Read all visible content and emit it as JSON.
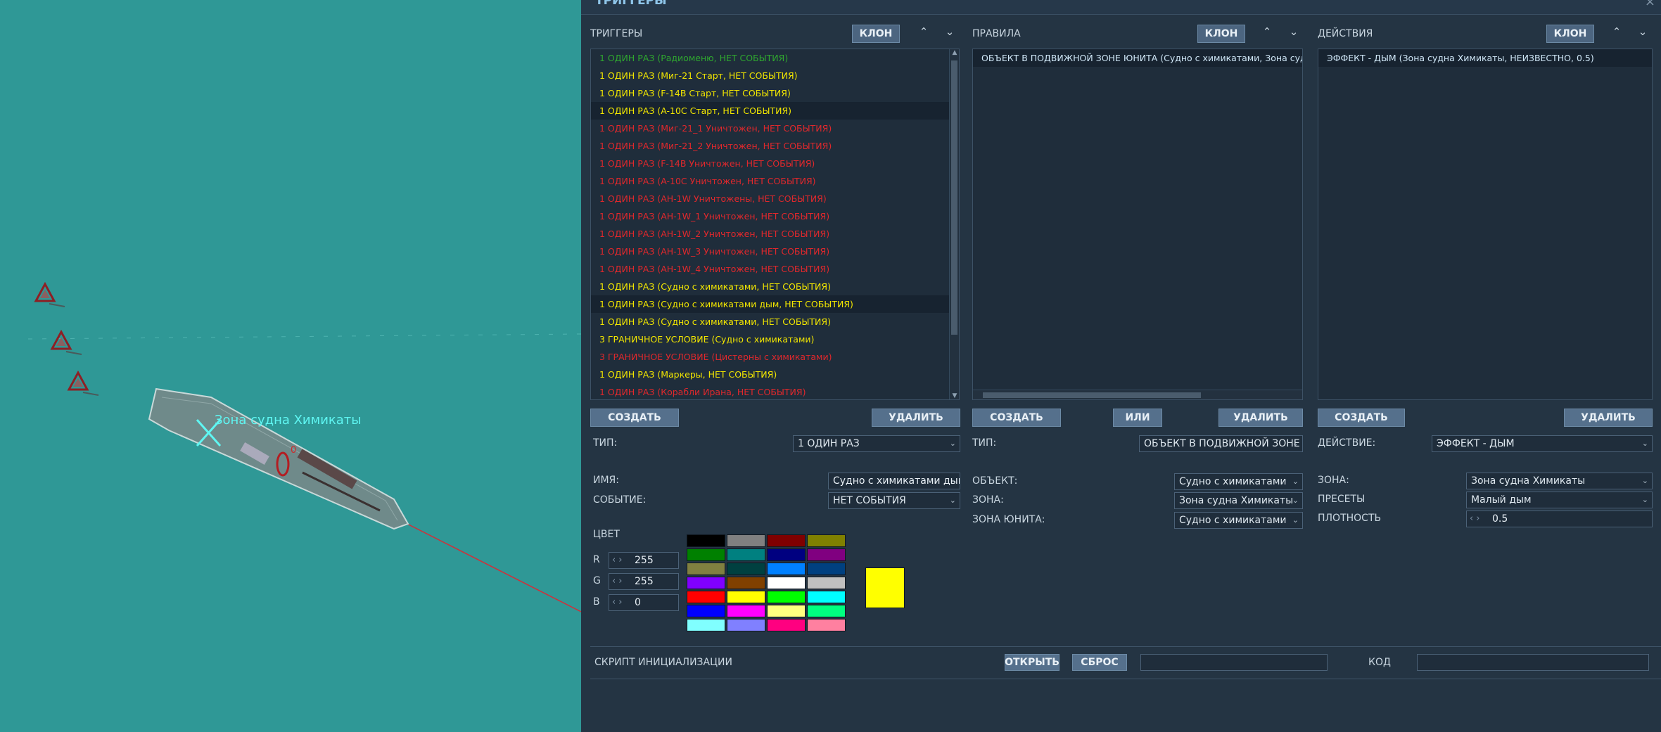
{
  "map": {
    "zone_label": "Зона судна Химикаты",
    "ship_marker": "0",
    "colors": {
      "water": "#2f9896",
      "zone": "#5ff6f2",
      "route": "#d0303a"
    }
  },
  "window": {
    "title": "ТРИГГЕРЫ",
    "close": "×"
  },
  "triggers": {
    "header": "ТРИГГЕРЫ",
    "clone": "КЛОН",
    "up_icon": "⌃",
    "down_icon": "⌄",
    "items": [
      {
        "text": "1 ОДИН РАЗ (Радиоменю, НЕТ СОБЫТИЯ)",
        "color": "#2fa82f"
      },
      {
        "text": "1 ОДИН РАЗ (Миг-21 Старт, НЕТ СОБЫТИЯ)",
        "color": "#f2e600"
      },
      {
        "text": "1 ОДИН РАЗ (F-14B Старт, НЕТ СОБЫТИЯ)",
        "color": "#f2e600"
      },
      {
        "text": "1 ОДИН РАЗ (A-10C Старт, НЕТ СОБЫТИЯ)",
        "color": "#f2e600"
      },
      {
        "text": "1 ОДИН РАЗ (Миг-21_1 Уничтожен, НЕТ СОБЫТИЯ)",
        "color": "#e0282c"
      },
      {
        "text": "1 ОДИН РАЗ (Миг-21_2 Уничтожен, НЕТ СОБЫТИЯ)",
        "color": "#e0282c"
      },
      {
        "text": "1 ОДИН РАЗ (F-14B Уничтожен, НЕТ СОБЫТИЯ)",
        "color": "#e0282c"
      },
      {
        "text": "1 ОДИН РАЗ (A-10C Уничтожен, НЕТ СОБЫТИЯ)",
        "color": "#e0282c"
      },
      {
        "text": "1 ОДИН РАЗ (AH-1W Уничтожены, НЕТ СОБЫТИЯ)",
        "color": "#e0282c"
      },
      {
        "text": "1 ОДИН РАЗ (AH-1W_1 Уничтожен, НЕТ СОБЫТИЯ)",
        "color": "#e0282c"
      },
      {
        "text": "1 ОДИН РАЗ (AH-1W_2 Уничтожен, НЕТ СОБЫТИЯ)",
        "color": "#e0282c"
      },
      {
        "text": "1 ОДИН РАЗ (AH-1W_3 Уничтожен, НЕТ СОБЫТИЯ)",
        "color": "#e0282c"
      },
      {
        "text": "1 ОДИН РАЗ (AH-1W_4 Уничтожен, НЕТ СОБЫТИЯ)",
        "color": "#e0282c"
      },
      {
        "text": "1 ОДИН РАЗ (Судно с химикатами, НЕТ СОБЫТИЯ)",
        "color": "#f2e600"
      },
      {
        "text": "1 ОДИН РАЗ (Судно с химикатами дым, НЕТ СОБЫТИЯ)",
        "color": "#f2e600"
      },
      {
        "text": "1 ОДИН РАЗ (Судно с химикатами, НЕТ СОБЫТИЯ)",
        "color": "#f2e600"
      },
      {
        "text": "3 ГРАНИЧНОЕ УСЛОВИЕ (Судно с химикатами)",
        "color": "#f2e600"
      },
      {
        "text": "3 ГРАНИЧНОЕ УСЛОВИЕ (Цистерны с химикатами)",
        "color": "#e0282c"
      },
      {
        "text": "1 ОДИН РАЗ (Маркеры, НЕТ СОБЫТИЯ)",
        "color": "#f2e600"
      },
      {
        "text": "1 ОДИН РАЗ (Корабли Ирана, НЕТ СОБЫТИЯ)",
        "color": "#e0282c"
      }
    ],
    "create": "СОЗДАТЬ",
    "delete": "УДАЛИТЬ",
    "type_label": "ТИП:",
    "type_value": "1 ОДИН РАЗ",
    "name_label": "ИМЯ:",
    "name_value": "Судно с химикатами дым",
    "event_label": "СОБЫТИЕ:",
    "event_value": "НЕТ СОБЫТИЯ",
    "color_label": "ЦВЕТ",
    "r_label": "R",
    "r_value": "255",
    "g_label": "G",
    "g_value": "255",
    "b_label": "B",
    "b_value": "0",
    "palette": [
      "#000000",
      "#808080",
      "#800000",
      "#808000",
      "#008000",
      "#008080",
      "#000080",
      "#800080",
      "#808040",
      "#004040",
      "#0080ff",
      "#004080",
      "#8000ff",
      "#804000",
      "#ffffff",
      "#c0c0c0",
      "#ff0000",
      "#ffff00",
      "#00ff00",
      "#00ffff",
      "#0000ff",
      "#ff00ff",
      "#ffff80",
      "#00ff80",
      "#80ffff",
      "#8080ff",
      "#ff0080",
      "#ff80a0"
    ],
    "selected_color": "#ffff00"
  },
  "rules": {
    "header": "ПРАВИЛА",
    "clone": "КЛОН",
    "items": [
      "ОБЪЕКТ В ПОДВИЖНОЙ ЗОНЕ ЮНИТА (Судно с химикатами, Зона судна Химикаты)"
    ],
    "create": "СОЗДАТЬ",
    "or": "ИЛИ",
    "delete": "УДАЛИТЬ",
    "type_label": "ТИП:",
    "type_value": "ОБЪЕКТ В ПОДВИЖНОЙ ЗОНЕ ЮНИТА",
    "object_label": "ОБЪЕКТ:",
    "object_value": "Судно с химикатами",
    "zone_label": "ЗОНА:",
    "zone_value": "Зона судна Химикаты",
    "unit_zone_label": "ЗОНА ЮНИТА:",
    "unit_zone_value": "Судно с химикатами"
  },
  "actions": {
    "header": "ДЕЙСТВИЯ",
    "clone": "КЛОН",
    "items": [
      "ЭФФЕКТ - ДЫМ (Зона судна Химикаты, НЕИЗВЕСТНО, 0.5)"
    ],
    "create": "СОЗДАТЬ",
    "delete": "УДАЛИТЬ",
    "action_label": "ДЕЙСТВИЕ:",
    "action_value": "ЭФФЕКТ - ДЫМ",
    "zone_label": "ЗОНА:",
    "zone_value": "Зона судна Химикаты",
    "presets_label": "ПРЕСЕТЫ",
    "presets_value": "Малый дым",
    "density_label": "ПЛОТНОСТЬ",
    "density_value": "0.5"
  },
  "init_script": {
    "label": "СКРИПТ ИНИЦИАЛИЗАЦИИ",
    "open": "ОТКРЫТЬ",
    "reset": "СБРОС",
    "file_value": "",
    "code_label": "КОД",
    "code_value": ""
  }
}
